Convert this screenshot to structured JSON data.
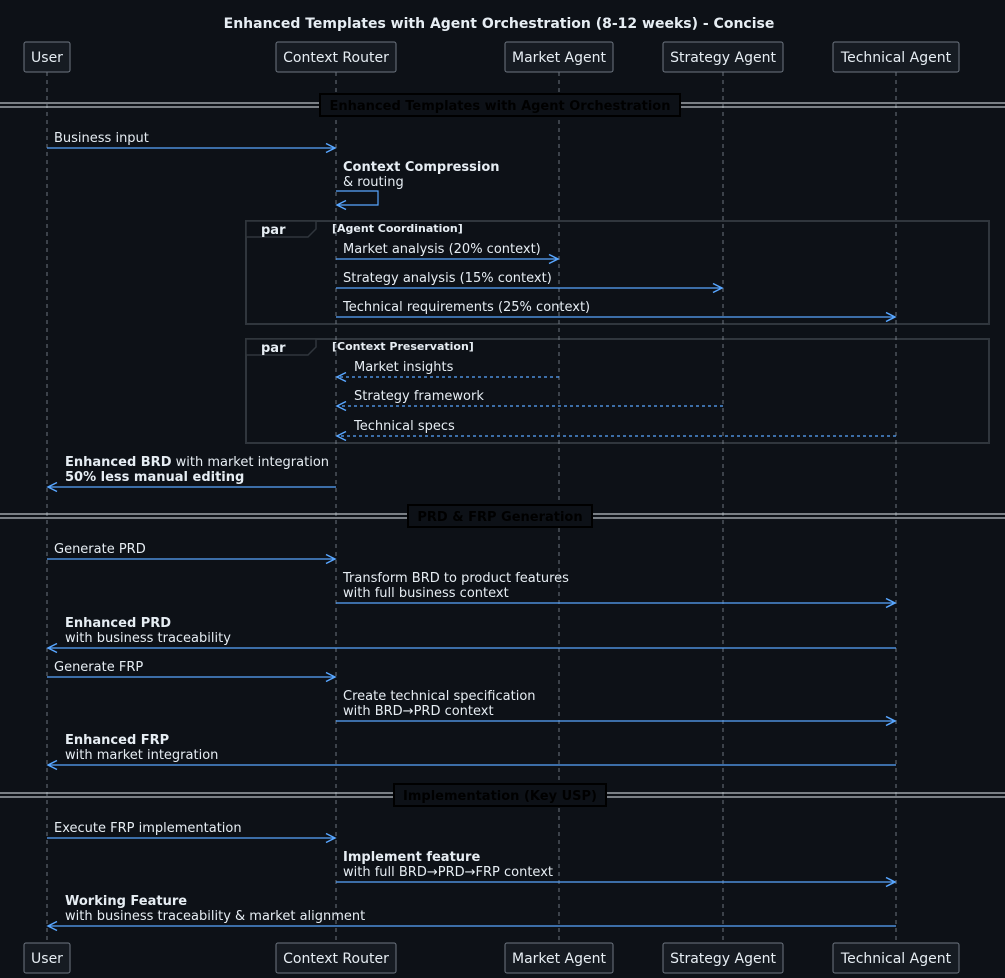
{
  "title": "Enhanced Templates with Agent Orchestration (8-12 weeks) - Concise",
  "participants": [
    "User",
    "Context Router",
    "Market Agent",
    "Strategy Agent",
    "Technical Agent"
  ],
  "dividers": [
    "Enhanced Templates with Agent Orchestration",
    "PRD & FRP Generation",
    "Implementation (Key USP)"
  ],
  "fragments": [
    {
      "keyword": "par",
      "condition": "[Agent Coordination]"
    },
    {
      "keyword": "par",
      "condition": "[Context Preservation]"
    }
  ],
  "messages": [
    {
      "from": "User",
      "to": "Context Router",
      "lines": [
        [
          {
            "t": "Business input"
          }
        ]
      ]
    },
    {
      "from": "Context Router",
      "to": "Context Router",
      "lines": [
        [
          {
            "t": "Context Compression",
            "b": true
          }
        ],
        [
          {
            "t": "& routing"
          }
        ]
      ]
    },
    {
      "from": "Context Router",
      "to": "Market Agent",
      "lines": [
        [
          {
            "t": "Market analysis (20% context)"
          }
        ]
      ]
    },
    {
      "from": "Context Router",
      "to": "Strategy Agent",
      "lines": [
        [
          {
            "t": "Strategy analysis (15% context)"
          }
        ]
      ]
    },
    {
      "from": "Context Router",
      "to": "Technical Agent",
      "lines": [
        [
          {
            "t": "Technical requirements (25% context)"
          }
        ]
      ]
    },
    {
      "from": "Market Agent",
      "to": "Context Router",
      "dashed": true,
      "lines": [
        [
          {
            "t": "Market insights"
          }
        ]
      ]
    },
    {
      "from": "Strategy Agent",
      "to": "Context Router",
      "dashed": true,
      "lines": [
        [
          {
            "t": "Strategy framework"
          }
        ]
      ]
    },
    {
      "from": "Technical Agent",
      "to": "Context Router",
      "dashed": true,
      "lines": [
        [
          {
            "t": "Technical specs"
          }
        ]
      ]
    },
    {
      "from": "Context Router",
      "to": "User",
      "lines": [
        [
          {
            "t": "Enhanced BRD",
            "b": true
          },
          {
            "t": " with market integration"
          }
        ],
        [
          {
            "t": "50% less manual editing",
            "b": true
          }
        ]
      ]
    },
    {
      "from": "User",
      "to": "Context Router",
      "lines": [
        [
          {
            "t": "Generate PRD"
          }
        ]
      ]
    },
    {
      "from": "Context Router",
      "to": "Technical Agent",
      "lines": [
        [
          {
            "t": "Transform BRD to product features"
          }
        ],
        [
          {
            "t": "with full business context"
          }
        ]
      ]
    },
    {
      "from": "Technical Agent",
      "to": "User",
      "lines": [
        [
          {
            "t": "Enhanced PRD",
            "b": true
          }
        ],
        [
          {
            "t": "with business traceability"
          }
        ]
      ]
    },
    {
      "from": "User",
      "to": "Context Router",
      "lines": [
        [
          {
            "t": "Generate FRP"
          }
        ]
      ]
    },
    {
      "from": "Context Router",
      "to": "Technical Agent",
      "lines": [
        [
          {
            "t": "Create technical specification"
          }
        ],
        [
          {
            "t": "with BRD→PRD context"
          }
        ]
      ]
    },
    {
      "from": "Technical Agent",
      "to": "User",
      "lines": [
        [
          {
            "t": "Enhanced FRP",
            "b": true
          }
        ],
        [
          {
            "t": "with market integration"
          }
        ]
      ]
    },
    {
      "from": "User",
      "to": "Context Router",
      "lines": [
        [
          {
            "t": "Execute FRP implementation"
          }
        ]
      ]
    },
    {
      "from": "Context Router",
      "to": "Technical Agent",
      "lines": [
        [
          {
            "t": "Implement feature",
            "b": true
          }
        ],
        [
          {
            "t": "with full BRD→PRD→FRP context"
          }
        ]
      ]
    },
    {
      "from": "Technical Agent",
      "to": "User",
      "lines": [
        [
          {
            "t": "Working Feature",
            "b": true
          }
        ],
        [
          {
            "t": "with business traceability & market alignment"
          }
        ]
      ]
    }
  ],
  "colors": {
    "background": "#0d1117",
    "arrow": "#58a6ff",
    "text": "#e6edf3",
    "participant_fill": "#161b22",
    "participant_border": "#6e7681",
    "fragment_border": "#30363d"
  }
}
